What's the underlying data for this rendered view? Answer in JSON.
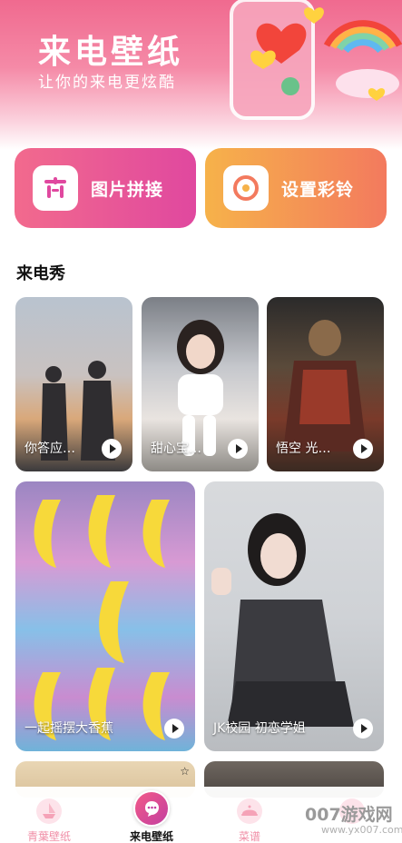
{
  "header": {
    "title": "来电壁纸",
    "subtitle": "让你的来电更炫酷"
  },
  "actions": [
    {
      "label": "图片拼接",
      "icon": "puzzle-grid-icon"
    },
    {
      "label": "设置彩铃",
      "icon": "vinyl-disc-icon"
    }
  ],
  "section": {
    "title": "来电秀"
  },
  "tiles": [
    {
      "caption": "你答应…",
      "icon": "play-icon"
    },
    {
      "caption": "甜心宝…",
      "icon": "play-icon"
    },
    {
      "caption": "悟空 光…",
      "icon": "play-icon"
    },
    {
      "caption": "一起摇摆大香蕉",
      "icon": "play-icon"
    },
    {
      "caption": "JK校园 初恋学姐",
      "icon": "play-icon"
    },
    {
      "caption": "",
      "icon": "star-icon",
      "mark": "☆"
    },
    {
      "caption": "",
      "icon": ""
    }
  ],
  "nav": {
    "items": [
      {
        "label": "青葉壁纸",
        "icon": "ship-icon",
        "active": false
      },
      {
        "label": "来电壁纸",
        "icon": "phone-call-icon",
        "active": true
      },
      {
        "label": "菜谱",
        "icon": "dish-icon",
        "active": false
      },
      {
        "label": "",
        "icon": "",
        "active": false
      }
    ]
  },
  "watermark": {
    "main": "007游戏网",
    "sub": "www.yx007.com"
  },
  "colors": {
    "header_top": "#f06a8f",
    "card_left": "#e0489f",
    "card_right": "#f6b24a",
    "nav_accent": "#f08da6"
  }
}
